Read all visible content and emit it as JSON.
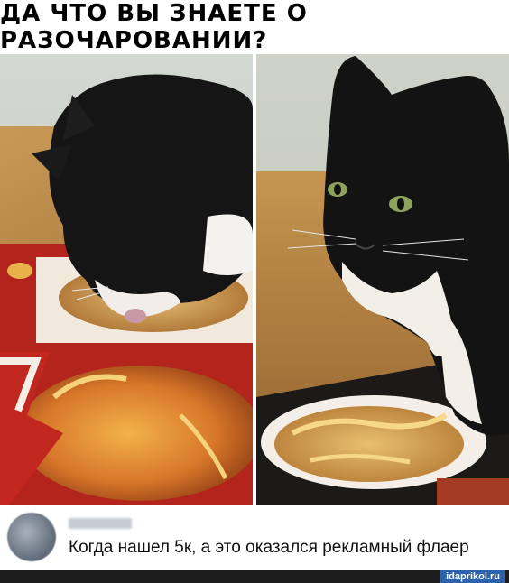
{
  "meme": {
    "title": "ДА ЧТО ВЫ ЗНАЕТЕ О РАЗОЧАРОВАНИИ?"
  },
  "photos": [
    {
      "subject": "cat-licking-flyer"
    },
    {
      "subject": "cat-staring"
    }
  ],
  "comment": {
    "text": "Когда нашел 5к, а это оказался рекламный флаер"
  },
  "watermark": "idaprikol.ru"
}
